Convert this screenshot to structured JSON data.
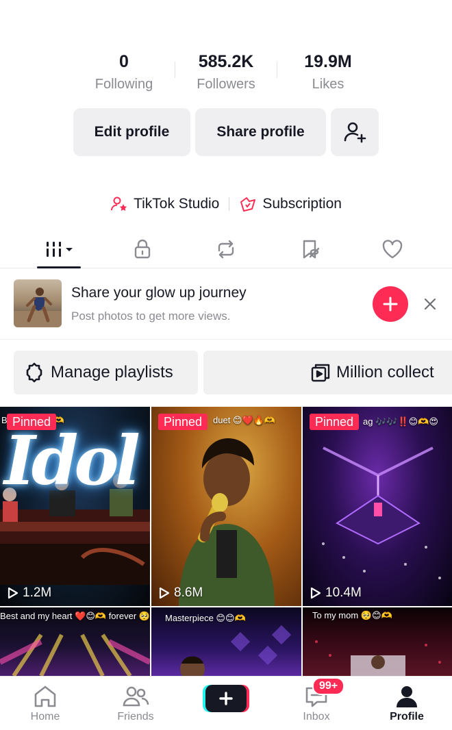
{
  "stats": {
    "following": {
      "value": "0",
      "label": "Following"
    },
    "followers": {
      "value": "585.2K",
      "label": "Followers"
    },
    "likes": {
      "value": "19.9M",
      "label": "Likes"
    }
  },
  "actions": {
    "edit": "Edit profile",
    "share": "Share profile",
    "add_friend_icon": "person-plus-icon"
  },
  "studio": {
    "studio_label": "TikTok Studio",
    "subscription_label": "Subscription"
  },
  "tabs": [
    {
      "icon": "videos-grid-icon",
      "active": true
    },
    {
      "icon": "lock-icon"
    },
    {
      "icon": "repost-icon"
    },
    {
      "icon": "favorites-icon"
    },
    {
      "icon": "heart-icon"
    }
  ],
  "banner": {
    "title": "Share your glow up journey",
    "subtitle": "Post photos to get more views."
  },
  "playlists": {
    "manage": "Manage playlists",
    "collection": "Million collect"
  },
  "videos": [
    {
      "pinned": "Pinned",
      "caption": "Be... ance 😊🫶",
      "views": "1.2M",
      "overlay": "Idol"
    },
    {
      "pinned": "Pinned",
      "caption": "duet 😊❤️🔥🫶",
      "views": "8.6M"
    },
    {
      "pinned": "Pinned",
      "caption": "ag 🎶🎶‼️😊🫶😍",
      "views": "10.4M"
    },
    {
      "caption": "Best and my heart ❤️😊🫶 forever 🥺"
    },
    {
      "caption": "Masterpiece 😊😊🫶"
    },
    {
      "caption": "To my mom 🥺😊🫶"
    }
  ],
  "nav": {
    "home": "Home",
    "friends": "Friends",
    "inbox": "Inbox",
    "inbox_badge": "99+",
    "profile": "Profile"
  },
  "colors": {
    "accent": "#fe2c55",
    "text": "#161823",
    "muted": "#8a8b91"
  }
}
